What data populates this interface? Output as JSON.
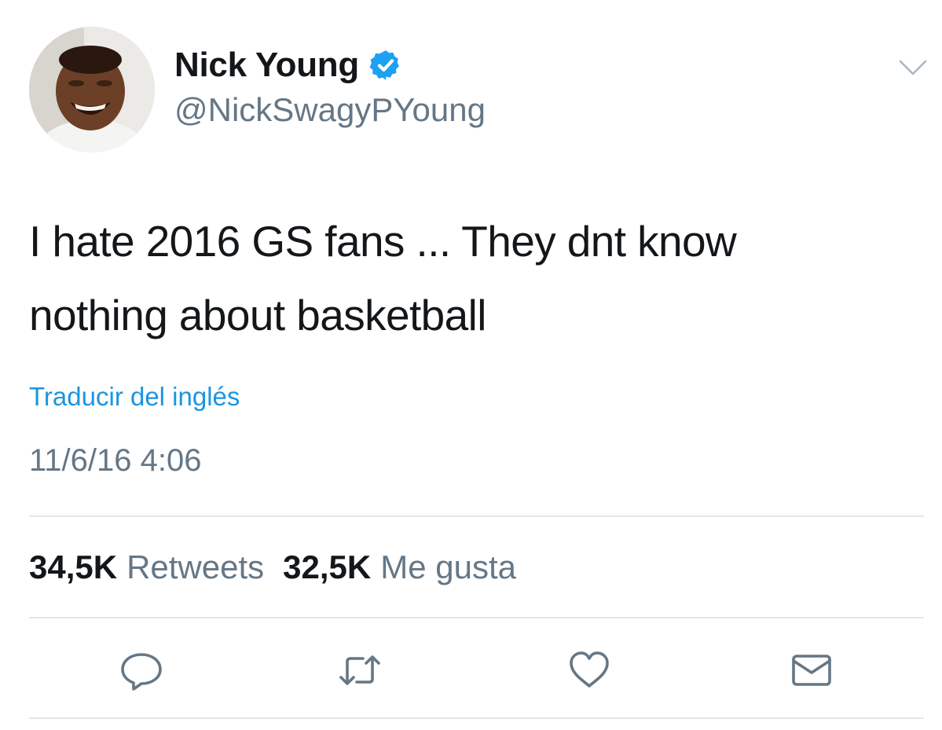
{
  "user": {
    "display_name": "Nick Young",
    "handle": "@NickSwagyPYoung",
    "verified": true,
    "avatar_icon": "profile-photo"
  },
  "tweet": {
    "lines": [
      "I hate 2016 GS fans ... They dnt know",
      "nothing about basketball"
    ],
    "translate_link": "Traducir del inglés",
    "timestamp": "11/6/16 4:06"
  },
  "stats": {
    "retweets_count": "34,5K",
    "retweets_label": "Retweets",
    "likes_count": "32,5K",
    "likes_label": "Me gusta"
  },
  "actions": [
    {
      "icon": "reply-icon"
    },
    {
      "icon": "retweet-icon"
    },
    {
      "icon": "heart-icon"
    },
    {
      "icon": "direct-message-icon"
    }
  ],
  "colors": {
    "text_primary": "#14171a",
    "text_secondary": "#657786",
    "link": "#1b95e0",
    "verified_badge": "#1da1f2",
    "divider": "#e1e8ed"
  }
}
